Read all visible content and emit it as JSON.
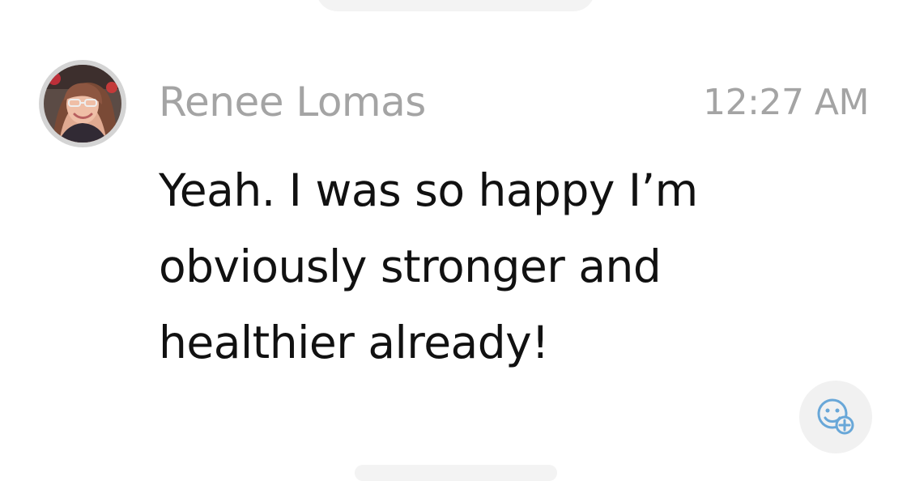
{
  "message": {
    "sender": "Renee Lomas",
    "timestamp": "12:27 AM",
    "body_lines": [
      "Yeah. I was so happy I’m",
      "obviously stronger and",
      "healthier already!"
    ],
    "avatar_icon": "user-avatar-photo"
  },
  "actions": {
    "reaction_icon": "add-reaction-icon"
  },
  "colors": {
    "meta_text": "#a4a4a4",
    "body_text": "#111111",
    "reaction_icon": "#68a7d8",
    "button_bg": "#f1f1f1"
  }
}
